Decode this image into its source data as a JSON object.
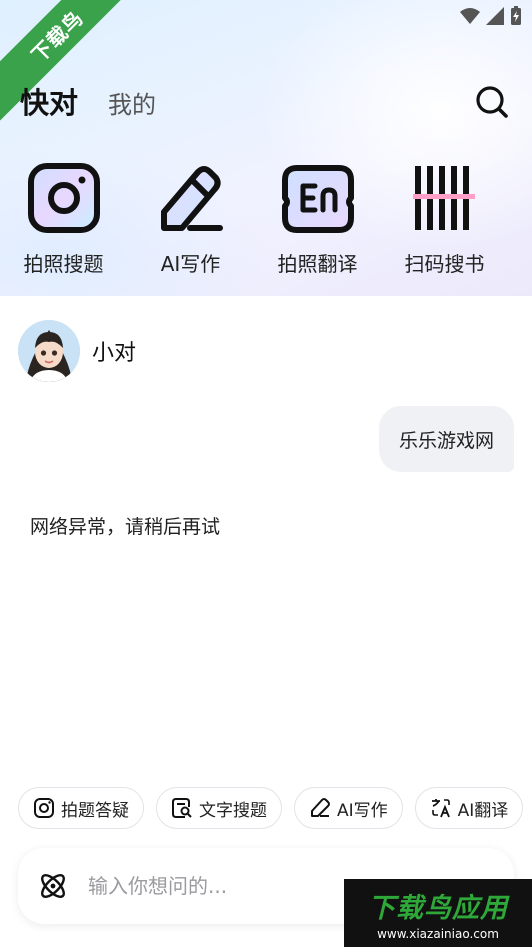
{
  "ribbon": {
    "text": "下载鸟"
  },
  "header": {
    "tabs": [
      {
        "label": "快对",
        "active": true
      },
      {
        "label": "我的",
        "active": false
      }
    ]
  },
  "tools": [
    {
      "label": "拍照搜题",
      "icon": "camera-icon"
    },
    {
      "label": "AI写作",
      "icon": "pen-icon"
    },
    {
      "label": "拍照翻译",
      "icon": "translate-en-icon"
    },
    {
      "label": "扫码搜书",
      "icon": "barcode-icon"
    }
  ],
  "chat": {
    "bot_name": "小对",
    "user_message": "乐乐游戏网",
    "bot_message": "网络异常，请稍后再试"
  },
  "chips": [
    {
      "label": "拍题答疑",
      "icon": "camera-icon"
    },
    {
      "label": "文字搜题",
      "icon": "text-search-icon"
    },
    {
      "label": "AI写作",
      "icon": "pen-icon"
    },
    {
      "label": "AI翻译",
      "icon": "translate-icon"
    }
  ],
  "input": {
    "placeholder": "输入你想问的..."
  },
  "watermark": {
    "title": "下载鸟应用",
    "url": "www.xiazainiao.com"
  },
  "colors": {
    "ribbon": "#3aa24b",
    "accent_text": "#111111",
    "bubble": "#f0f1f4"
  }
}
